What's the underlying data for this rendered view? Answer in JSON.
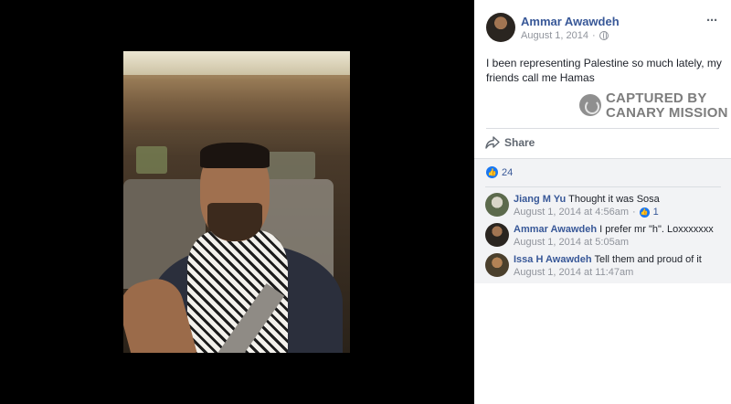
{
  "post": {
    "author": "Ammar Awawdeh",
    "date": "August 1, 2014",
    "privacy_icon": "globe-icon",
    "text": "I been representing Palestine so much lately, my friends call me Hamas",
    "more_icon": "···",
    "share_label": "Share",
    "like_count": "24"
  },
  "watermark": {
    "line1": "CAPTURED BY",
    "line2": "CANARY MISSION"
  },
  "comments": [
    {
      "name": "Jiang M Yu",
      "text": "Thought it was Sosa",
      "time": "August 1, 2014 at 4:56am",
      "likes": "1"
    },
    {
      "name": "Ammar Awawdeh",
      "text": "I prefer mr \"h\". Loxxxxxxx",
      "time": "August 1, 2014 at 5:05am"
    },
    {
      "name": "Issa H Awawdeh",
      "text": "Tell them and proud of it",
      "time": "August 1, 2014 at 11:47am"
    }
  ],
  "colors": {
    "link": "#385898",
    "meta": "#90949c",
    "like": "#1877f2"
  }
}
